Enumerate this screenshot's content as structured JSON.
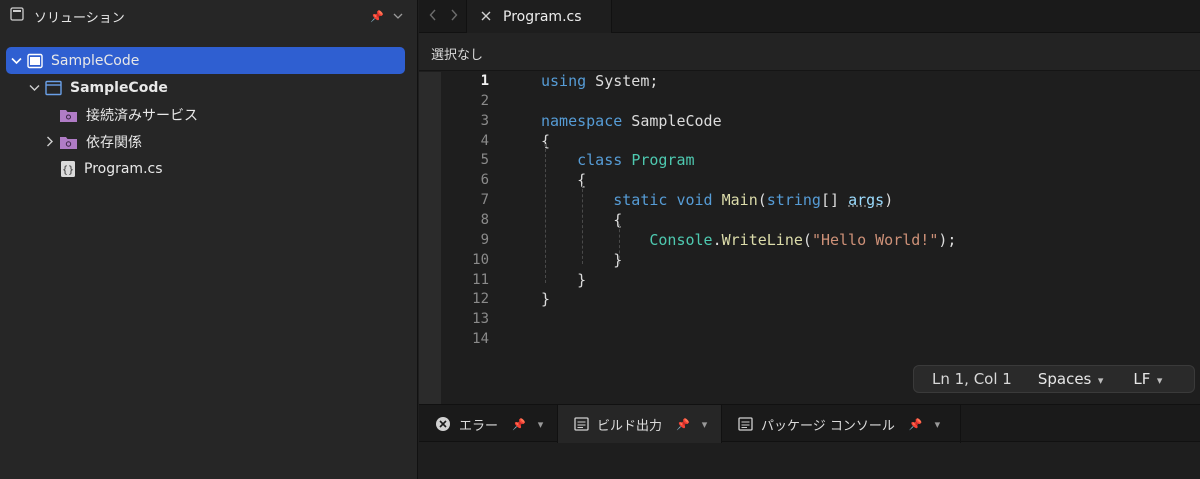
{
  "sidebar": {
    "title": "ソリューション",
    "icons": {
      "panel": "solution-panel-icon",
      "pin": "pin-icon",
      "menu": "chevron-down-icon"
    },
    "tree": [
      {
        "label": "SampleCode",
        "level": 0,
        "expanded": true,
        "selected": true,
        "icon": "solution-icon"
      },
      {
        "label": "SampleCode",
        "level": 1,
        "expanded": true,
        "bold": true,
        "icon": "project-icon"
      },
      {
        "label": "接続済みサービス",
        "level": 2,
        "icon": "connected-services-folder-icon"
      },
      {
        "label": "依存関係",
        "level": 2,
        "collapsed": true,
        "icon": "dependencies-folder-icon"
      },
      {
        "label": "Program.cs",
        "level": 2,
        "icon": "csharp-file-icon"
      }
    ]
  },
  "tabs": {
    "active_tab": "Program.cs",
    "icons": {
      "back": "chevron-left-icon",
      "forward": "chevron-right-icon",
      "close": "close-icon"
    }
  },
  "breadcrumb": {
    "text": "選択なし"
  },
  "editor": {
    "current_line": 1,
    "lines": [
      [
        [
          "kw",
          "using"
        ],
        [
          "pn",
          " System;"
        ]
      ],
      [],
      [
        [
          "kw",
          "namespace"
        ],
        [
          "pn",
          " SampleCode"
        ]
      ],
      [
        [
          "pn",
          "{"
        ]
      ],
      [
        [
          "pn",
          "    "
        ],
        [
          "kw",
          "class"
        ],
        [
          "pn",
          " "
        ],
        [
          "ty",
          "Program"
        ]
      ],
      [
        [
          "pn",
          "    {"
        ]
      ],
      [
        [
          "pn",
          "        "
        ],
        [
          "kw",
          "static"
        ],
        [
          "pn",
          " "
        ],
        [
          "kw",
          "void"
        ],
        [
          "pn",
          " "
        ],
        [
          "fn",
          "Main"
        ],
        [
          "pn",
          "("
        ],
        [
          "kw",
          "string"
        ],
        [
          "pn",
          "[] "
        ],
        [
          "pa",
          "args"
        ],
        [
          "pn",
          ")"
        ]
      ],
      [
        [
          "pn",
          "        {"
        ]
      ],
      [
        [
          "pn",
          "            "
        ],
        [
          "ty",
          "Console"
        ],
        [
          "pn",
          "."
        ],
        [
          "fn",
          "WriteLine"
        ],
        [
          "pn",
          "("
        ],
        [
          "st",
          "\"Hello World!\""
        ],
        [
          "pn",
          ");"
        ]
      ],
      [
        [
          "pn",
          "        }"
        ]
      ],
      [
        [
          "pn",
          "    }"
        ]
      ],
      [
        [
          "pn",
          "}"
        ]
      ],
      [],
      []
    ]
  },
  "status": {
    "position": "Ln 1, Col 1",
    "indentation": "Spaces",
    "line_endings": "LF"
  },
  "bottom_tabs": [
    {
      "label": "エラー",
      "icon": "error-circle-icon",
      "active": false
    },
    {
      "label": "ビルド出力",
      "icon": "output-panel-icon",
      "active": true
    },
    {
      "label": "パッケージ コンソール",
      "icon": "package-console-icon",
      "active": false
    }
  ],
  "colors": {
    "accent": "#2f5fd1",
    "keyword": "#569cd6",
    "type": "#4ec9b0",
    "method": "#dcdcaa",
    "string": "#ce9178",
    "folder": "#b07cc6"
  }
}
